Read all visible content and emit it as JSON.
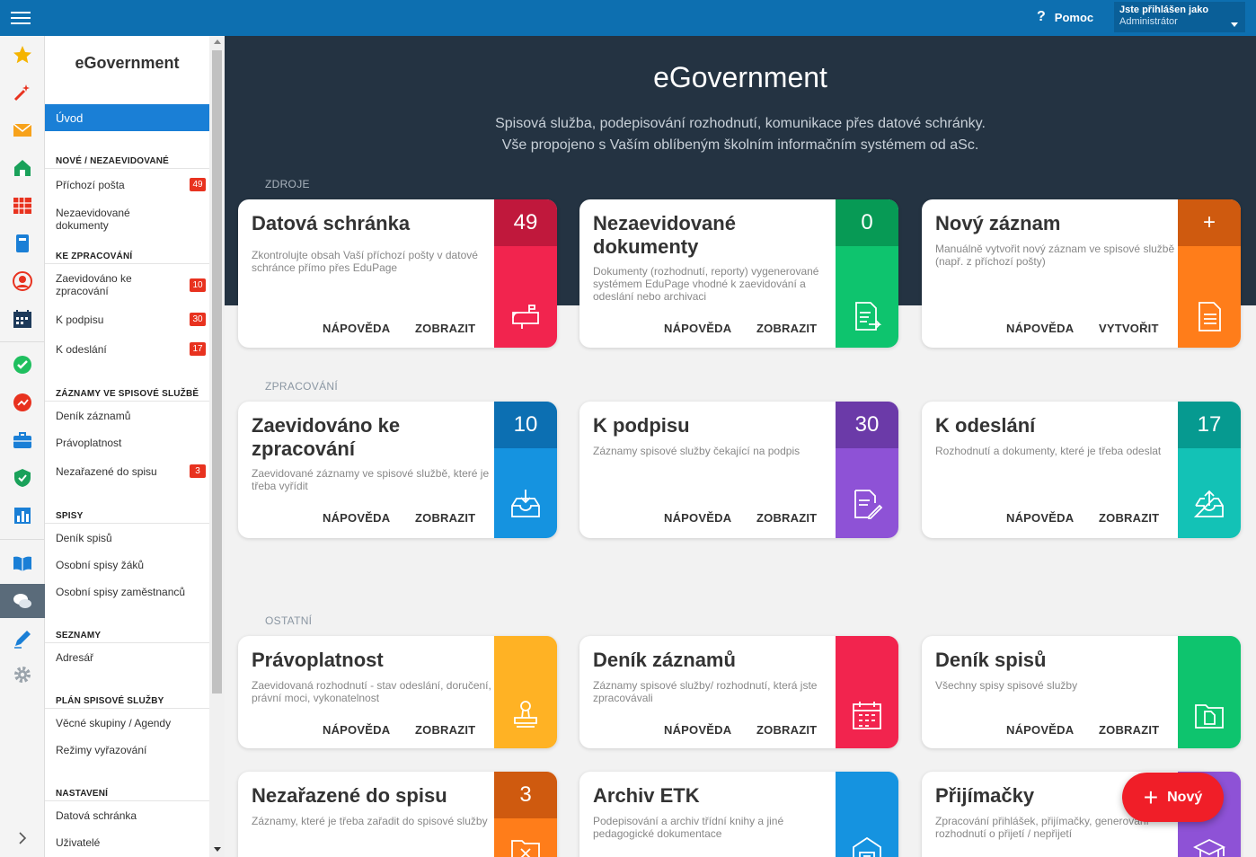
{
  "topbar": {
    "help_label": "Pomoc",
    "user_line1": "Jste přihlášen jako",
    "user_line2": "Administrátor"
  },
  "sidebar": {
    "title": "eGovernment",
    "home": "Úvod",
    "sections": [
      {
        "label": "NOVÉ / NEZAEVIDOVANÉ",
        "items": [
          {
            "label": "Příchozí pošta",
            "badge": "49"
          },
          {
            "label": "Nezaevidované dokumenty"
          }
        ]
      },
      {
        "label": "KE ZPRACOVÁNÍ",
        "items": [
          {
            "label": "Zaevidováno ke zpracování",
            "badge": "10"
          },
          {
            "label": "K podpisu",
            "badge": "30"
          },
          {
            "label": "K odeslání",
            "badge": "17"
          }
        ]
      },
      {
        "label": "ZÁZNAMY VE SPISOVÉ SLUŽBĚ",
        "items": [
          {
            "label": "Deník záznamů"
          },
          {
            "label": "Právoplatnost"
          },
          {
            "label": "Nezařazené do spisu",
            "badge": "3"
          }
        ]
      },
      {
        "label": "SPISY",
        "items": [
          {
            "label": "Deník spisů"
          },
          {
            "label": "Osobní spisy žáků"
          },
          {
            "label": "Osobní spisy zaměstnanců"
          }
        ]
      },
      {
        "label": "SEZNAMY",
        "items": [
          {
            "label": "Adresář"
          }
        ]
      },
      {
        "label": "PLÁN SPISOVÉ SLUŽBY",
        "items": [
          {
            "label": "Věcné skupiny / Agendy"
          },
          {
            "label": "Režimy vyřazování"
          }
        ]
      },
      {
        "label": "NASTAVENÍ",
        "items": [
          {
            "label": "Datová schránka"
          },
          {
            "label": "Uživatelé"
          }
        ]
      }
    ]
  },
  "hero": {
    "title": "eGovernment",
    "line1": "Spisová služba, podepisování rozhodnutí, komunikace přes datové schránky.",
    "line2": "Vše propojeno s Vaším oblíbeným školním informačním systémem od aSc."
  },
  "sections": {
    "zdroje": "ZDROJE",
    "zpracovani": "ZPRACOVÁNÍ",
    "ostatni": "OSTATNÍ"
  },
  "cards": [
    {
      "title": "Datová schránka",
      "desc": "Zkontrolujte obsah Vaší příchozí pošty v datové schránce přímo přes EduPage",
      "count": "49",
      "btn1": "NÁPOVĚDA",
      "btn2": "ZOBRAZIT",
      "icon": "mailbox-icon",
      "color_top": "#c0183c",
      "color": "#f2244e"
    },
    {
      "title": "Nezaevidované dokumenty",
      "desc": "Dokumenty (rozhodnutí, reporty) vygenerované systémem EduPage vhodné k zaevidování a odeslání nebo archivaci",
      "count": "0",
      "btn1": "NÁPOVĚDA",
      "btn2": "ZOBRAZIT",
      "icon": "document-arrow-icon",
      "color_top": "#079a55",
      "color": "#0ec46e"
    },
    {
      "title": "Nový záznam",
      "desc": "Manuálně vytvořit nový záznam ve spisové službě (např. z příchozí pošty)",
      "count": "+",
      "btn1": "NÁPOVĚDA",
      "btn2": "VYTVOŘIT",
      "icon": "document-icon",
      "color_top": "#cf5a0f",
      "color": "#ff7d1a"
    },
    {
      "title": "Zaevidováno ke zpracování",
      "desc": "Zaevidované záznamy ve spisové službě, které je třeba vyřídit",
      "count": "10",
      "btn1": "NÁPOVĚDA",
      "btn2": "ZOBRAZIT",
      "icon": "inbox-download-icon",
      "color_top": "#0c6fb2",
      "color": "#1593e0"
    },
    {
      "title": "K podpisu",
      "desc": "Záznamy spisové služby čekající na podpis",
      "count": "30",
      "btn1": "NÁPOVĚDA",
      "btn2": "ZOBRAZIT",
      "icon": "sign-document-icon",
      "color_top": "#6b3aa8",
      "color": "#8e52d6"
    },
    {
      "title": "K odeslání",
      "desc": "Rozhodnutí a dokumenty, které je třeba odeslat",
      "count": "17",
      "btn1": "NÁPOVĚDA",
      "btn2": "ZOBRAZIT",
      "icon": "outbox-upload-icon",
      "color_top": "#069a90",
      "color": "#13c2b6"
    },
    {
      "title": "Právoplatnost",
      "desc": "Zaevidovaná rozhodnutí - stav odeslání, doručení, právní moci, vykonatelnost",
      "count": "",
      "btn1": "NÁPOVĚDA",
      "btn2": "ZOBRAZIT",
      "icon": "stamp-icon",
      "color_top": "#ffb224",
      "color": "#ffb224"
    },
    {
      "title": "Deník záznamů",
      "desc": "Záznamy spisové služby/ rozhodnutí, která jste zpracovávali",
      "count": "",
      "btn1": "NÁPOVĚDA",
      "btn2": "ZOBRAZIT",
      "icon": "calendar-clock-icon",
      "color_top": "#f2244e",
      "color": "#f2244e"
    },
    {
      "title": "Deník spisů",
      "desc": "Všechny spisy spisové služby",
      "count": "",
      "btn1": "NÁPOVĚDA",
      "btn2": "ZOBRAZIT",
      "icon": "folder-document-icon",
      "color_top": "#0ec46e",
      "color": "#0ec46e"
    },
    {
      "title": "Nezařazené do spisu",
      "desc": "Záznamy, které je třeba zařadit do spisové služby",
      "count": "3",
      "btn1": "",
      "btn2": "",
      "icon": "folder-x-icon",
      "color_top": "#cf5a0f",
      "color": "#ff7d1a"
    },
    {
      "title": "Archiv ETK",
      "desc": "Podepisování a archiv třídní knihy a jiné pedagogické dokumentace",
      "count": "",
      "btn1": "",
      "btn2": "",
      "icon": "archive-icon",
      "color_top": "#1593e0",
      "color": "#1593e0"
    },
    {
      "title": "Přijímačky",
      "desc": "Zpracování přihlášek, přijímačky, generování rozhodnutí o přijetí / nepřijetí",
      "count": "",
      "btn1": "",
      "btn2": "",
      "icon": "graduation-cap-icon",
      "color_top": "#8e52d6",
      "color": "#8e52d6"
    }
  ],
  "fab": {
    "label": "Nový"
  }
}
